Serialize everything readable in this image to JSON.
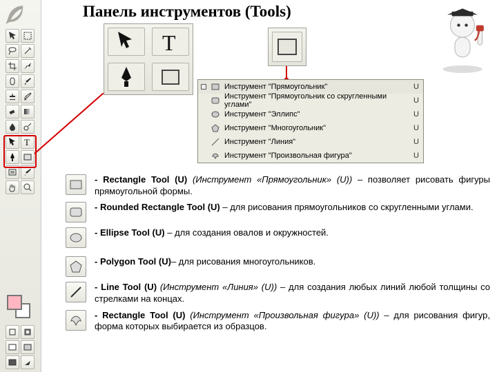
{
  "title": "Панель инструментов (Tools)",
  "menu": {
    "items": [
      {
        "label": "Инструмент \"Прямоугольник\"",
        "shortcut": "U"
      },
      {
        "label": "Инструмент \"Прямоугольник со скругленными углами\"",
        "shortcut": "U"
      },
      {
        "label": "Инструмент \"Эллипс\"",
        "shortcut": "U"
      },
      {
        "label": "Инструмент \"Многоугольник\"",
        "shortcut": "U"
      },
      {
        "label": "Инструмент \"Линия\"",
        "shortcut": "U"
      },
      {
        "label": "Инструмент \"Произвольная фигура\"",
        "shortcut": "U"
      }
    ]
  },
  "desc": [
    {
      "bold": "- Rectangle Tool (U)",
      "ital": " (Инструмент «Прямоугольник» (U)) ",
      "rest": "– позволяет рисовать фигуры прямоугольной формы."
    },
    {
      "bold": "- Rounded Rectangle Tool (U) ",
      "ital": "",
      "rest": "– для рисования прямоугольников со скругленными углами."
    },
    {
      "bold": "- Ellipse Tool (U) ",
      "ital": "",
      "rest": "– для создания овалов и окружностей."
    },
    {
      "bold": "- Polygon Tool (U)",
      "ital": "",
      "rest": "– для рисования многоугольников."
    },
    {
      "bold": "- Line Tool (U) ",
      "ital": "(Инструмент «Линия» (U)) ",
      "rest": "– для создания любых линий  любой толщины со стрелками на концах."
    },
    {
      "bold": "- Rectangle Tool (U) ",
      "ital": "(Инструмент «Произвольная фигура» (U)) ",
      "rest": "– для рисования фигур, форма которых выбирается из образцов."
    }
  ]
}
